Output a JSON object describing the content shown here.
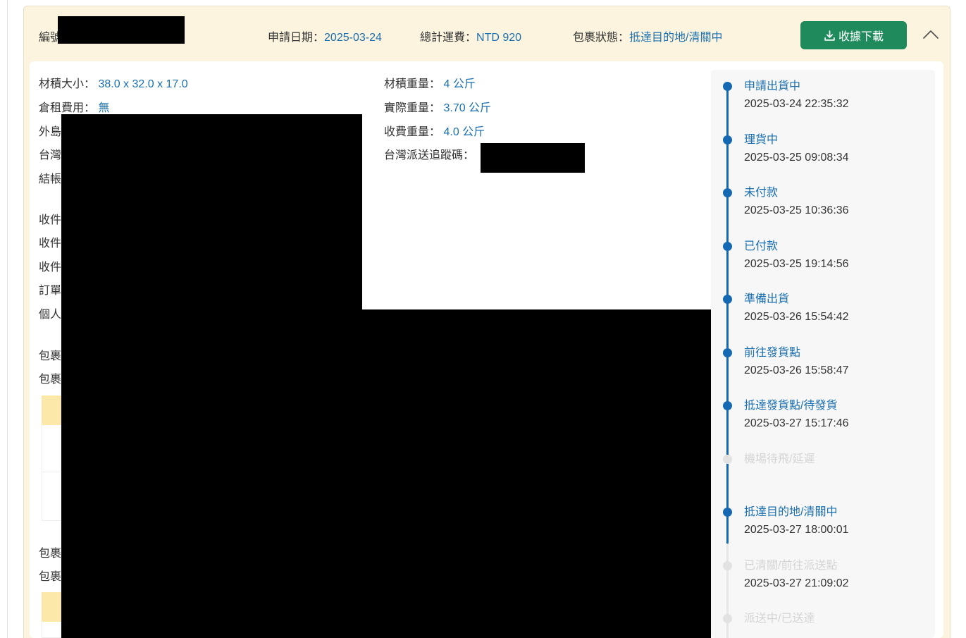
{
  "header": {
    "id_label": "編號",
    "apply_date_label": "申請日期：",
    "apply_date": "2025-03-24",
    "total_fee_label": "總計運費：",
    "total_fee": "NTD 920",
    "status_label": "包裹狀態：",
    "status": "抵達目的地/清關中",
    "download_label": "收據下載"
  },
  "details_left": [
    {
      "label": "材積大小：",
      "value": "38.0 x 32.0 x 17.0"
    },
    {
      "label": "倉租費用：",
      "value": "無"
    },
    {
      "label": "外島",
      "value": ""
    },
    {
      "label": "台灣",
      "value": ""
    },
    {
      "label": "結帳",
      "value": ""
    },
    {
      "label": "收件",
      "value": ""
    },
    {
      "label": "收件",
      "value": ""
    },
    {
      "label": "收件",
      "value": ""
    },
    {
      "label": "訂單",
      "value": ""
    },
    {
      "label": "個人",
      "value": ""
    },
    {
      "label": "包裹",
      "value": ""
    },
    {
      "label": "包裹",
      "value": ""
    },
    {
      "label": "包裹",
      "value": ""
    },
    {
      "label": "包裹",
      "value": ""
    }
  ],
  "details_right": [
    {
      "label": "材積重量：",
      "value": "4 公斤"
    },
    {
      "label": "實際重量：",
      "value": "3.70 公斤"
    },
    {
      "label": "收費重量：",
      "value": "4.0 公斤"
    },
    {
      "label": "台灣派送追蹤碼：",
      "value": ""
    }
  ],
  "timeline": [
    {
      "status": "申請出貨中",
      "time": "2025-03-24 22:35:32",
      "done": true
    },
    {
      "status": "理貨中",
      "time": "2025-03-25 09:08:34",
      "done": true
    },
    {
      "status": "未付款",
      "time": "2025-03-25 10:36:36",
      "done": true
    },
    {
      "status": "已付款",
      "time": "2025-03-25 19:14:56",
      "done": true
    },
    {
      "status": "準備出貨",
      "time": "2025-03-26 15:54:42",
      "done": true
    },
    {
      "status": "前往發貨點",
      "time": "2025-03-26 15:58:47",
      "done": true
    },
    {
      "status": "抵達發貨點/待發貨",
      "time": "2025-03-27 15:17:46",
      "done": true
    },
    {
      "status": "機場待飛/延遲",
      "time": "",
      "done": false
    },
    {
      "status": "抵達目的地/清關中",
      "time": "2025-03-27 18:00:01",
      "done": true
    },
    {
      "status": "已清關/前往派送點",
      "time": "2025-03-27 21:09:02",
      "done": false
    },
    {
      "status": "派送中/已送達",
      "time": "",
      "done": false
    }
  ],
  "colors": {
    "accent": "#1a6fb0",
    "done_dot": "#1569b3",
    "pending_dot": "#e2e2e2",
    "pending_text": "#d4d4d4",
    "download_button": "#1f8a5c",
    "card_background": "#fcf4de",
    "table_header": "#fce8a8"
  },
  "icons": {
    "download": "download-icon",
    "collapse": "chevron-up-icon"
  }
}
